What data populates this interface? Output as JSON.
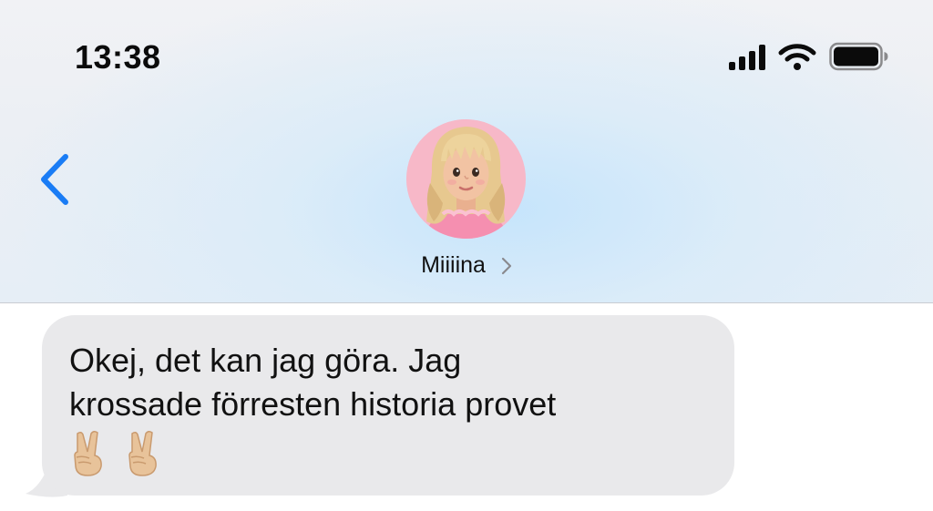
{
  "status_bar": {
    "time": "13:38",
    "icons": [
      "cellular-signal-icon",
      "wifi-icon",
      "battery-icon"
    ]
  },
  "header": {
    "back_icon": "chevron-left-icon",
    "contact_name": "Miiiina",
    "contact_chevron_icon": "chevron-right-icon",
    "avatar": "memoji-avatar"
  },
  "messages": [
    {
      "direction": "incoming",
      "lines": [
        "Okej, det kan jag göra. Jag",
        "krossade förresten historia provet"
      ],
      "emoji": [
        "✌🏼",
        "✌🏼"
      ]
    }
  ],
  "colors": {
    "accent": "#1a7cf5",
    "incoming_bubble": "#e9e9eb",
    "avatar_background": "#f7b8c8"
  }
}
